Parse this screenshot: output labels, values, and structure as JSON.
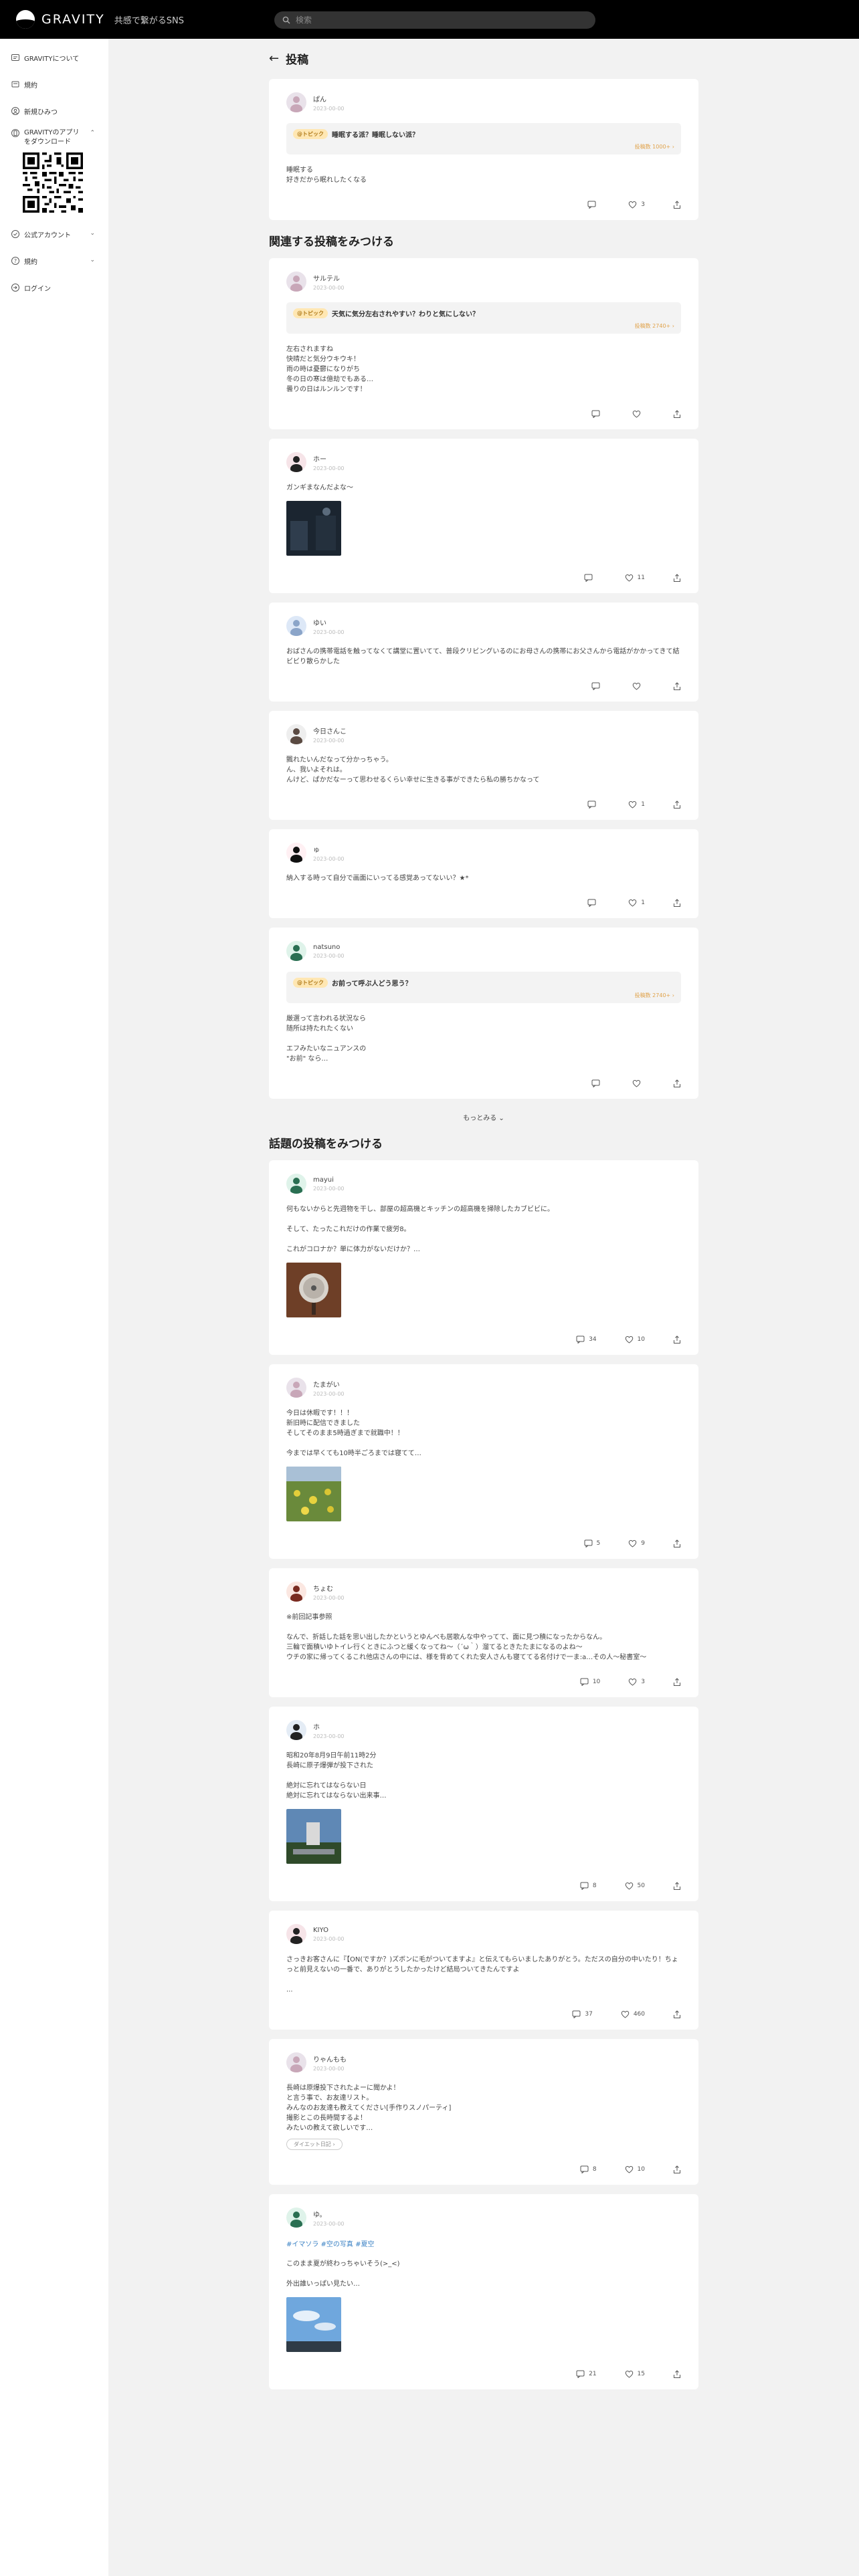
{
  "header": {
    "logo_text": "GRAVITY",
    "tagline": "共感で繋がるSNS",
    "search_placeholder": "検索"
  },
  "sidebar": {
    "items": [
      {
        "label": "GRAVITYについて",
        "icon": "info-card-icon"
      },
      {
        "label": "規約",
        "icon": "document-icon"
      },
      {
        "label": "新規ひみつ",
        "icon": "user-plus-icon"
      }
    ],
    "app_label": "GRAVITYのアプリをダウンロード",
    "official_label": "公式アカウント",
    "help_label": "規約",
    "login_label": "ログイン"
  },
  "page": {
    "title": "投稿",
    "related_title": "関連する投稿をみつける",
    "trending_title": "話題の投稿をみつける",
    "more_label": "もっとみる"
  },
  "main_post": {
    "user": "ぱん",
    "date": "2023-00-00",
    "topic_badge": "@トピック",
    "topic": "睡眠する派？睡眠しない派？",
    "topic_count": "投稿数 1000+ ›",
    "body": "睡眠する\n好きだから眠れしたくなる",
    "comments": "",
    "likes": "3"
  },
  "related_posts": [
    {
      "user": "サルテル",
      "date": "2023-00-00",
      "avatar": "a1",
      "topic_badge": "@トピック",
      "topic": "天気に気分左右されやすい？わりと気にしない？",
      "topic_count": "投稿数 2740+ ›",
      "body": "左右されますね\n快晴だと気分ウキウキ！\n雨の時は憂鬱になりがち\n冬の日の寒は億劫でもある…\n曇りの日はルンルンです！",
      "image": "",
      "comments": "",
      "likes": ""
    },
    {
      "user": "ホー",
      "date": "2023-00-00",
      "avatar": "a2",
      "body": "ガンギまなんだよな～",
      "image": "dark",
      "comments": "",
      "likes": "11"
    },
    {
      "user": "ゆい",
      "date": "2023-00-00",
      "avatar": "a3",
      "body": "おばさんの携帯電話を触ってなくて講堂に置いてて、普段クリビングいるのにお母さんの携帯にお父さんから電話がかかってきて結ビビり散らかした",
      "image": "",
      "comments": "",
      "likes": ""
    },
    {
      "user": "今日さんこ",
      "date": "2023-00-00",
      "avatar": "a4",
      "body": "飄れたいんだなって分かっちゃう。\nん、我いよそれは。\nんけど、ぱかだなーって思わせるくらい幸せに生きる事ができたら私の勝ちかなって",
      "image": "",
      "comments": "",
      "likes": "1"
    },
    {
      "user": "ゅ",
      "date": "2023-00-00",
      "avatar": "a5",
      "body": "納入する時って自分で画面にいってる感覚あってないい？★*",
      "image": "",
      "comments": "",
      "likes": "1"
    },
    {
      "user": "natsuno",
      "date": "2023-00-00",
      "avatar": "a6",
      "topic_badge": "@トピック",
      "topic": "お前って呼ぶ人どう思う？",
      "topic_count": "投稿数 2740+ ›",
      "body": "厳選って言われる状況なら\n随所は持たれたくない\n\nエフみたいなニュアンスの\n\"お前\" なら…",
      "image": "",
      "comments": "",
      "likes": ""
    }
  ],
  "trending_posts": [
    {
      "user": "mayui",
      "date": "2023-00-00",
      "avatar": "a6",
      "body": "何もないからと先週物を干し、部屋の超高機とキッチンの超高機を掃除したカブビビに。\n\nそして、たったこれだけの作業で疲労8。\n\nこれがコロナか？単に体力がないだけか？…",
      "image": "brown",
      "tags": "",
      "chip": "",
      "comments": "34",
      "likes": "10"
    },
    {
      "user": "たまがい",
      "date": "2023-00-00",
      "avatar": "a1",
      "body": "今日は休暇です！！！\n新旧時に配信できました\nそしてそのまま5時過ぎまで就職中！！\n\n今までは早くても10時半ごろまでは寝てて…",
      "image": "green",
      "tags": "",
      "chip": "",
      "comments": "5",
      "likes": "9"
    },
    {
      "user": "ちょむ",
      "date": "2023-00-00",
      "avatar": "a8",
      "body": "※前回記事参照\n\nなんで、折話した話を思い出したかというとゆんべも居歌んな中やってて、面に見つ積になったからなん。\n三輪で面積いゆトイレ行くときにふつと緩くなってね～（´ω｀）溜てるときたたまになるのよね～\nウチの家に帰ってくるこれ他店さんの中には、様を背めてくれた安人さんも寝ててる名付けで一ま:a…その人～秘書室～",
      "image": "",
      "tags": "",
      "chip": "",
      "comments": "10",
      "likes": "3"
    },
    {
      "user": "ホ",
      "date": "2023-00-00",
      "avatar": "a7",
      "body": "昭和20年8月9日午前11時2分\n長崎に原子爆弾が投下された\n\n絶対に忘れてはならない日\n絶対に忘れてはならない出来事…",
      "image": "photo",
      "tags": "",
      "chip": "",
      "comments": "8",
      "likes": "50"
    },
    {
      "user": "KIYO",
      "date": "2023-00-00",
      "avatar": "a2",
      "body": "さっきお客さんに『【ON(ですか？)ズボンに毛がついてますよ』と伝えてもらいましたありがとう。ただスの自分の中いたり！ちょっと前見えないの一番で、ありがとうしたかったけど結局ついてきたんですよ\n\n...",
      "image": "",
      "tags": "",
      "chip": "",
      "comments": "37",
      "likes": "460"
    },
    {
      "user": "りゃんもも",
      "date": "2023-00-00",
      "avatar": "a1",
      "body": "長崎は原爆投下されたよーに聞かよ！\nと言う事で、お友達リスト。\nみんなのお友達も教えてください[手作りスノパーティ]\n撮影とこの長時間するよ！\nみたいの教えて欲しいです…",
      "image": "",
      "tags": "",
      "chip": "ダイエット日記 ›",
      "comments": "8",
      "likes": "10"
    },
    {
      "user": "ゆ。",
      "date": "2023-00-00",
      "avatar": "a6",
      "body": "このまま夏が終わっちゃいそう(>_<)\n\n外出誰いっぱい見たい…",
      "image": "sky",
      "tags": "#イマソラ #空の写真 #夏空",
      "chip": "",
      "comments": "21",
      "likes": "15"
    }
  ]
}
